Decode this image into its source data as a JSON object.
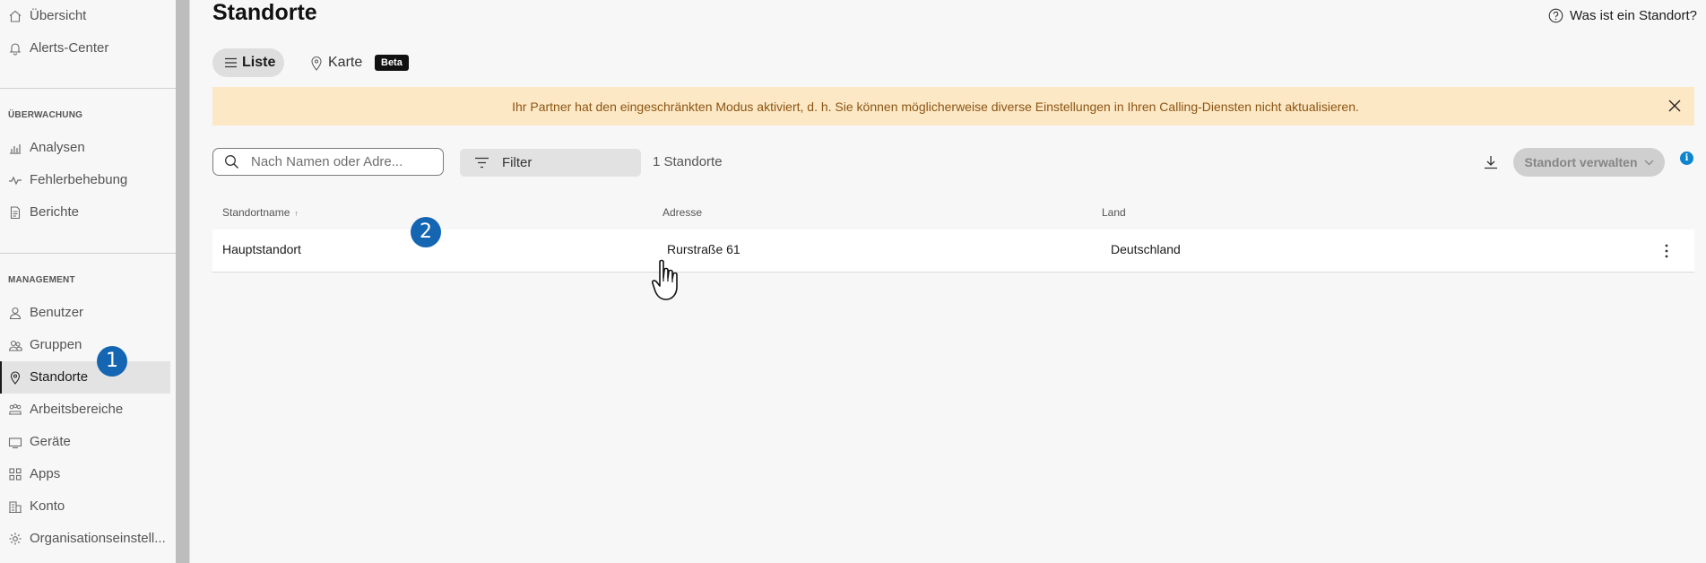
{
  "sidebar": {
    "top_items": [
      {
        "label": "Übersicht",
        "icon": "home-icon"
      },
      {
        "label": "Alerts-Center",
        "icon": "bell-icon"
      }
    ],
    "monitoring_title": "ÜBERWACHUNG",
    "monitoring_items": [
      {
        "label": "Analysen",
        "icon": "analytics-icon"
      },
      {
        "label": "Fehlerbehebung",
        "icon": "pulse-icon"
      },
      {
        "label": "Berichte",
        "icon": "report-icon"
      }
    ],
    "management_title": "MANAGEMENT",
    "management_items": [
      {
        "label": "Benutzer",
        "icon": "user-icon"
      },
      {
        "label": "Gruppen",
        "icon": "group-icon"
      },
      {
        "label": "Standorte",
        "icon": "location-pin-icon",
        "active": true
      },
      {
        "label": "Arbeitsbereiche",
        "icon": "workspace-icon"
      },
      {
        "label": "Geräte",
        "icon": "device-icon"
      },
      {
        "label": "Apps",
        "icon": "apps-grid-icon"
      },
      {
        "label": "Konto",
        "icon": "building-icon"
      },
      {
        "label": "Organisationseinstell...",
        "icon": "gear-icon"
      }
    ]
  },
  "header": {
    "title": "Standorte",
    "help_link": "Was ist ein Standort?"
  },
  "view_tabs": {
    "list_label": "Liste",
    "map_label": "Karte",
    "beta_badge": "Beta"
  },
  "alert": {
    "text": "Ihr Partner hat den eingeschränkten Modus aktiviert, d. h. Sie können möglicherweise diverse Einstellungen in Ihren Calling-Diensten nicht aktualisieren."
  },
  "toolbar": {
    "search_placeholder": "Nach Namen oder Adre...",
    "search_value": "",
    "filter_label": "Filter",
    "count_text": "1 Standorte",
    "manage_label": "Standort verwalten",
    "info_label": "i"
  },
  "table": {
    "columns": [
      "Standortname",
      "Adresse",
      "Land"
    ],
    "sort_indicator": "↑",
    "rows": [
      {
        "name": "Hauptstandort",
        "address": "Rurstraße 61",
        "country": "Deutschland"
      }
    ]
  },
  "annotations": {
    "step1": "1",
    "step2": "2"
  },
  "colors": {
    "accent_blue": "#1466b3",
    "alert_bg": "#fde8c5",
    "alert_text": "#8a5514",
    "info_blue": "#0d84cc"
  }
}
